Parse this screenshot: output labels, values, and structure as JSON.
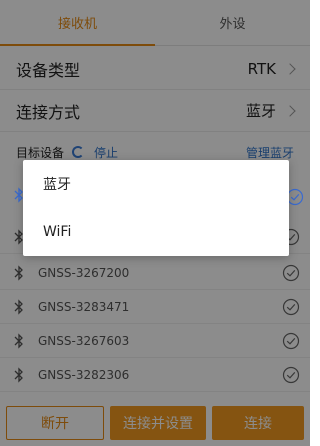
{
  "tabs": {
    "receiver": "接收机",
    "peripheral": "外设"
  },
  "settings": {
    "device_type_label": "设备类型",
    "device_type_value": "RTK",
    "connect_mode_label": "连接方式",
    "connect_mode_value": "蓝牙"
  },
  "target": {
    "label": "目标设备",
    "stop": "停止",
    "manage": "管理蓝牙"
  },
  "devices": [
    {
      "name": ""
    },
    {
      "name": ""
    },
    {
      "name": "GNSS-3267200"
    },
    {
      "name": "GNSS-3283471"
    },
    {
      "name": "GNSS-3267603"
    },
    {
      "name": "GNSS-3282306"
    }
  ],
  "dialog": {
    "options": [
      "蓝牙",
      "WiFi"
    ]
  },
  "buttons": {
    "disconnect": "断开",
    "connect_setup": "连接并设置",
    "connect": "连接"
  },
  "colors": {
    "accent": "#e58a14",
    "link": "#2f73c9",
    "icon": "#3a6bd0"
  }
}
